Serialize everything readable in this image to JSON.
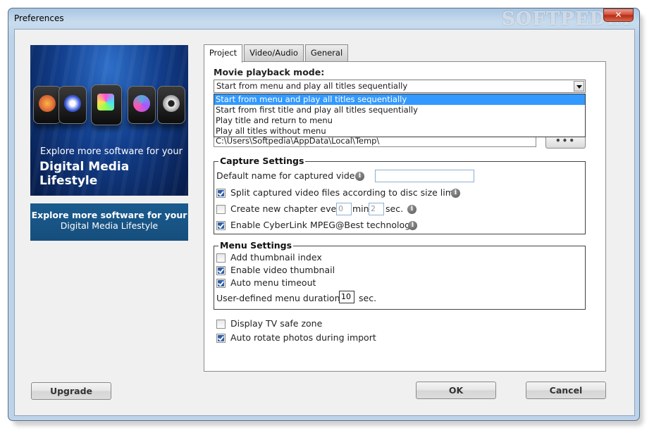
{
  "window": {
    "title": "Preferences",
    "watermark": "SOFTPEDIA",
    "close_glyph": "✕"
  },
  "banners": {
    "image_line1": "Explore more software for your",
    "image_line2": "Digital Media Lifestyle",
    "link_line1": "Explore more software for your",
    "link_line2": "Digital Media Lifestyle"
  },
  "tabs": [
    {
      "label": "Project",
      "active": true
    },
    {
      "label": "Video/Audio",
      "active": false
    },
    {
      "label": "General",
      "active": false
    }
  ],
  "project": {
    "playback_label": "Movie playback mode:",
    "playback_selected": "Start from menu and play all titles sequentially",
    "playback_options": [
      "Start from menu and play all titles sequentially",
      "Start from first title and play all titles sequentially",
      "Play title and return to menu",
      "Play all titles without menu"
    ],
    "temp_path": "C:\\Users\\Softpedia\\AppData\\Local\\Temp\\",
    "browse_label": "•••",
    "capture": {
      "title": "Capture Settings",
      "default_name_label": "Default name for captured video:",
      "default_name_value": "",
      "split_label": "Split captured video files according to disc size limit",
      "split_checked": true,
      "chapter_label": "Create new chapter every:",
      "chapter_checked": false,
      "chapter_min": "0",
      "min_unit": "min.",
      "chapter_sec": "2",
      "sec_unit": "sec.",
      "mpeg_label": "Enable CyberLink MPEG@Best technology",
      "mpeg_checked": true
    },
    "menu": {
      "title": "Menu Settings",
      "thumb_index_label": "Add thumbnail index",
      "thumb_index_checked": false,
      "video_thumb_label": "Enable video thumbnail",
      "video_thumb_checked": true,
      "auto_timeout_label": "Auto menu timeout",
      "auto_timeout_checked": true,
      "duration_label": "User-defined menu duration",
      "duration_value": "10",
      "duration_unit": "sec."
    },
    "tv_safe_label": "Display TV safe zone",
    "tv_safe_checked": false,
    "auto_rotate_label": "Auto rotate photos during import",
    "auto_rotate_checked": true
  },
  "buttons": {
    "upgrade": "Upgrade",
    "ok": "OK",
    "cancel": "Cancel"
  },
  "colors": {
    "accent": "#3399ff",
    "banner_blue": "#164e7c",
    "check_blue": "#2c5ea8"
  },
  "icons": [
    "close-icon",
    "info-icon",
    "checkbox-checked",
    "dropdown-arrow-icon"
  ]
}
